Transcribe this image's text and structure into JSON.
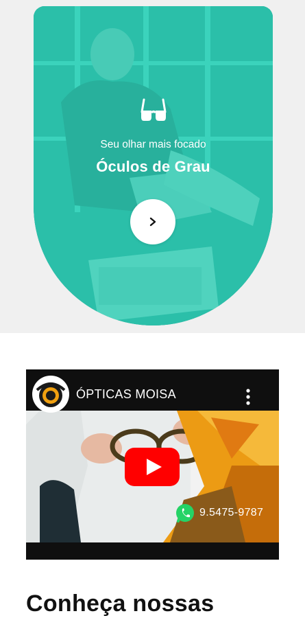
{
  "hero_card": {
    "subtitle": "Seu olhar mais focado",
    "title": "Óculos de Grau",
    "icon": "glasses-icon",
    "button_icon": "chevron-right-icon",
    "colors": {
      "accent": "#2fcfb7",
      "button": "#ffffff"
    }
  },
  "video": {
    "channel_name": "ÓPTICAS MOISA",
    "phone": "9.5475-9787",
    "icons": [
      "channel-logo",
      "more-vert-icon",
      "youtube-play-icon",
      "whatsapp-icon"
    ],
    "colors": {
      "play": "#ff0000",
      "banner": "#f0a010"
    }
  },
  "section": {
    "heading": "Conheça nossas"
  }
}
